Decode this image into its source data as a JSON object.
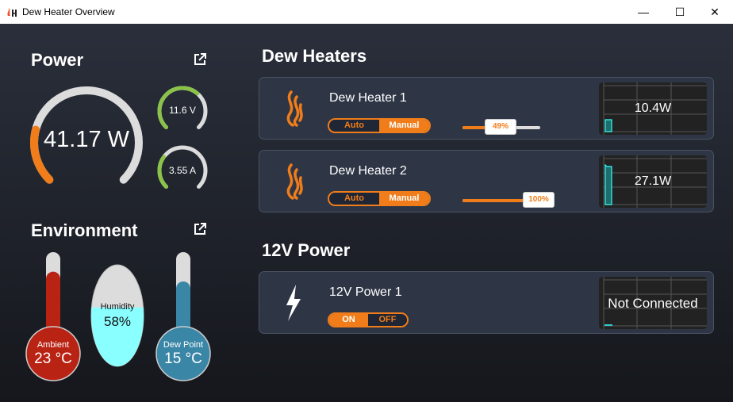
{
  "window": {
    "title": "Dew Heater Overview",
    "minimize": "—",
    "maximize": "☐",
    "close": "✕"
  },
  "power": {
    "title": "Power",
    "total": "41.17 W",
    "total_fill": 0.22,
    "voltage": "11.6 V",
    "voltage_fill": 0.65,
    "current": "3.55 A",
    "current_fill": 0.3,
    "accent": "#f07d1a",
    "green": "#8bc34a"
  },
  "environment": {
    "title": "Environment",
    "ambient": {
      "label": "Ambient",
      "value": "23 °C",
      "fill": 0.78,
      "color": "#b92314"
    },
    "humidity": {
      "label": "Humidity",
      "value": "58%",
      "fill": 0.58,
      "color": "#8affff"
    },
    "dew_point": {
      "label": "Dew Point",
      "value": "15 °C",
      "fill": 0.67,
      "color": "#3a86a6"
    }
  },
  "dew_heaters": {
    "title": "Dew Heaters",
    "items": [
      {
        "name": "Dew Heater 1",
        "auto": "Auto",
        "manual": "Manual",
        "mode": "Manual",
        "level": "49%",
        "level_value": 0.49,
        "power": "10.4W"
      },
      {
        "name": "Dew Heater 2",
        "auto": "Auto",
        "manual": "Manual",
        "mode": "Manual",
        "level": "100%",
        "level_value": 1.0,
        "power": "27.1W"
      }
    ]
  },
  "power12v": {
    "title": "12V Power",
    "items": [
      {
        "name": "12V Power 1",
        "on": "ON",
        "off": "OFF",
        "state": "ON",
        "status": "Not Connected"
      }
    ]
  }
}
